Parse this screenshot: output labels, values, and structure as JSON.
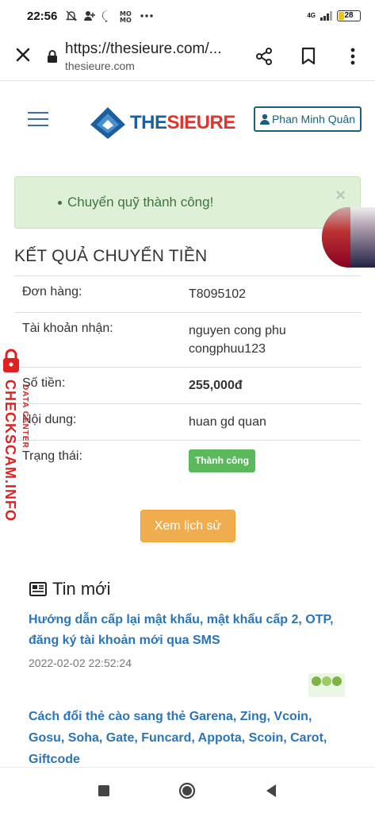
{
  "status_bar": {
    "time": "22:56",
    "network": "4G",
    "battery": "28",
    "icons": [
      "silent-icon",
      "person-add-icon",
      "messenger-icon",
      "mo-icon",
      "more-dots-icon"
    ]
  },
  "url_bar": {
    "url": "https://thesieure.com/...",
    "domain": "thesieure.com"
  },
  "header": {
    "logo_part1": "THE",
    "logo_part2": "SIEURE",
    "user_name": "Phan Minh Quân"
  },
  "alert": {
    "message": "Chuyển quỹ thành công!",
    "close": "×"
  },
  "result": {
    "title": "KẾT QUẢ CHUYỂN TIỀN",
    "rows": [
      {
        "label": "Đơn hàng:",
        "value": "T8095102"
      },
      {
        "label": "Tài khoản nhận:",
        "value": "nguyen cong phu",
        "value2": "congphuu123"
      },
      {
        "label": "Số tiền:",
        "value": "255,000đ"
      },
      {
        "label": "Nội dung:",
        "value": "huan gd quan"
      },
      {
        "label": "Trạng thái:",
        "value": "Thành công"
      }
    ],
    "history_button": "Xem lịch sử"
  },
  "news": {
    "heading": "Tin mới",
    "items": [
      {
        "title": "Hướng dẫn cấp lại mật khẩu, mật khẩu cấp 2, OTP, đăng ký tài khoản mới qua SMS",
        "date": "2022-02-02 22:52:24"
      },
      {
        "title": "Cách đổi thẻ cào sang thẻ Garena, Zing, Vcoin, Gosu, Soha, Gate, Funcard, Appota, Scoin, Carot, Giftcode"
      }
    ]
  },
  "watermark": {
    "main": "CHECKSCAM.INFO",
    "sub": "DATA CENTER"
  },
  "colors": {
    "link": "#2a74b8",
    "success": "#5cb85c",
    "warning_button": "#f0ad4e",
    "alert_bg": "#dff0d8",
    "brand_blue": "#1a5f9e",
    "brand_red": "#e0342c"
  }
}
